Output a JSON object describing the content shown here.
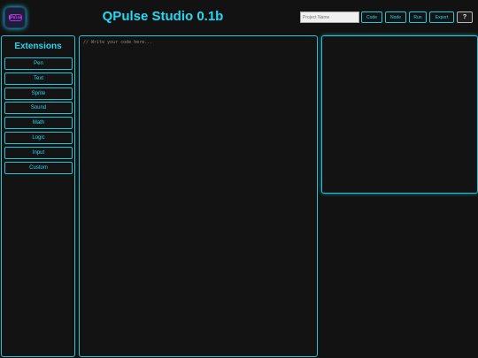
{
  "header": {
    "logo_text": "QPulse",
    "title": "QPulse Studio 0.1b",
    "project_placeholder": "Project Name",
    "buttons": {
      "code": "Code",
      "node": "Node",
      "run": "Run",
      "export": "Export",
      "help": "?"
    }
  },
  "sidebar": {
    "title": "Extensions",
    "items": [
      {
        "label": "Pen"
      },
      {
        "label": "Text"
      },
      {
        "label": "Sprite"
      },
      {
        "label": "Sound"
      },
      {
        "label": "Math"
      },
      {
        "label": "Logic"
      },
      {
        "label": "Input"
      },
      {
        "label": "Custom"
      }
    ]
  },
  "editor": {
    "placeholder": "// Write your code here..."
  },
  "theme": {
    "accent": "#23d9f2",
    "border": "#23c6d9",
    "background": "#121212",
    "logo_accent": "#c61cff"
  }
}
